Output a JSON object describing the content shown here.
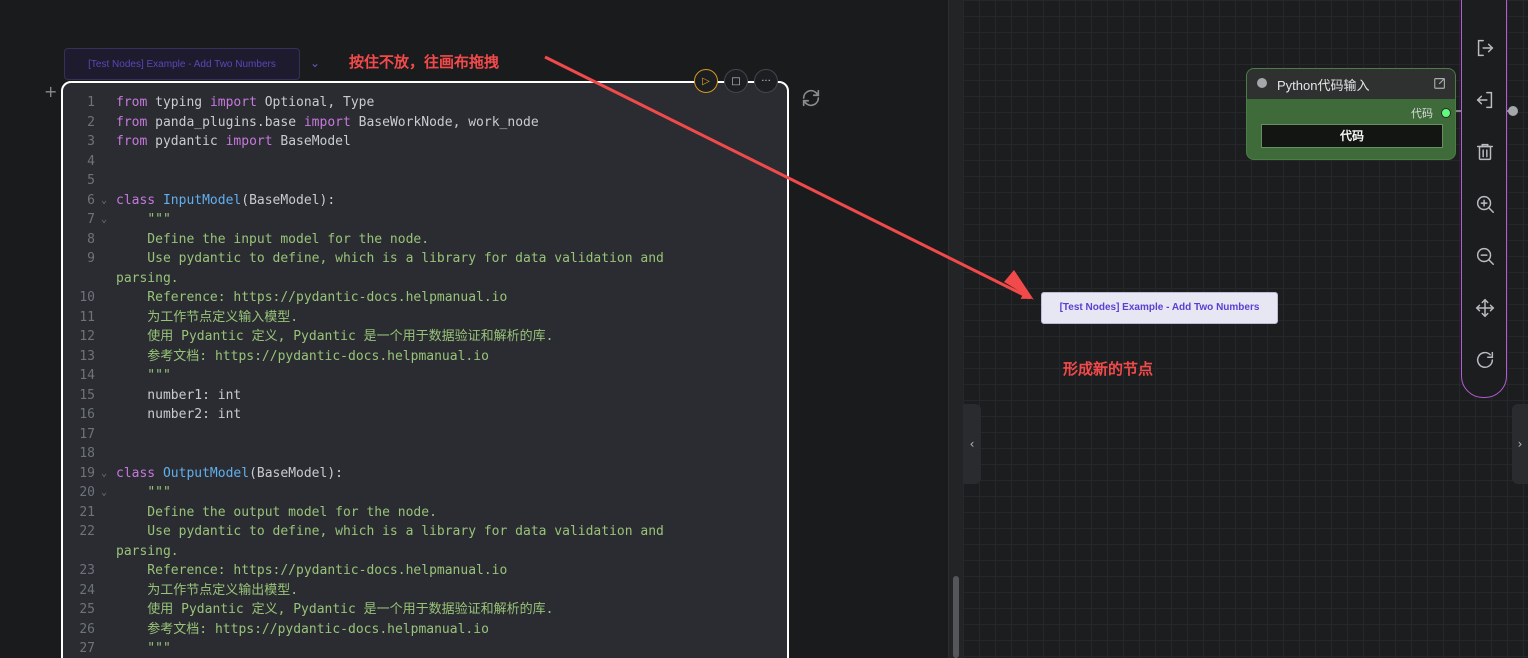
{
  "notebook": {
    "cell_tag": "[Test Nodes] Example - Add Two Numbers",
    "add_cell_glyph": "+",
    "chevron_glyph": "⌄",
    "annotation": "按住不放，往画布拖拽",
    "toolbar": {
      "run_glyph": "▷",
      "stop_glyph": "□",
      "more_glyph": "···"
    },
    "code_lines": [
      {
        "n": "1",
        "fold": "",
        "html": "<span class='kw'>from</span> typing <span class='kw'>import</span> Optional, Type"
      },
      {
        "n": "2",
        "fold": "",
        "html": "<span class='kw'>from</span> panda_plugins.base <span class='kw'>import</span> BaseWorkNode, work_node"
      },
      {
        "n": "3",
        "fold": "",
        "html": "<span class='kw'>from</span> pydantic <span class='kw'>import</span> BaseModel"
      },
      {
        "n": "4",
        "fold": "",
        "html": ""
      },
      {
        "n": "5",
        "fold": "",
        "html": ""
      },
      {
        "n": "6",
        "fold": "⌄",
        "html": "<span class='kw'>class</span> <span class='fn'>InputModel</span>(BaseModel):"
      },
      {
        "n": "7",
        "fold": "⌄",
        "html": "    <span class='str'>\"\"\"</span>"
      },
      {
        "n": "8",
        "fold": "",
        "html": "<span class='str'>    Define the input model for the node.</span>"
      },
      {
        "n": "9",
        "fold": "",
        "html": "<span class='str'>    Use pydantic to define, which is a library for data validation and</span>"
      },
      {
        "n": "",
        "fold": "",
        "html": "<span class='str'>parsing.</span>"
      },
      {
        "n": "10",
        "fold": "",
        "html": "<span class='str'>    Reference: https://pydantic-docs.helpmanual.io</span>"
      },
      {
        "n": "11",
        "fold": "",
        "html": "<span class='str'>    为工作节点定义输入模型.</span>"
      },
      {
        "n": "12",
        "fold": "",
        "html": "<span class='str'>    使用 Pydantic 定义, Pydantic 是一个用于数据验证和解析的库.</span>"
      },
      {
        "n": "13",
        "fold": "",
        "html": "<span class='str'>    参考文档: https://pydantic-docs.helpmanual.io</span>"
      },
      {
        "n": "14",
        "fold": "",
        "html": "<span class='str'>    \"\"\"</span>"
      },
      {
        "n": "15",
        "fold": "",
        "html": "    number1: int"
      },
      {
        "n": "16",
        "fold": "",
        "html": "    number2: int"
      },
      {
        "n": "17",
        "fold": "",
        "html": ""
      },
      {
        "n": "18",
        "fold": "",
        "html": ""
      },
      {
        "n": "19",
        "fold": "⌄",
        "html": "<span class='kw'>class</span> <span class='fn'>OutputModel</span>(BaseModel):"
      },
      {
        "n": "20",
        "fold": "⌄",
        "html": "    <span class='str'>\"\"\"</span>"
      },
      {
        "n": "21",
        "fold": "",
        "html": "<span class='str'>    Define the output model for the node.</span>"
      },
      {
        "n": "22",
        "fold": "",
        "html": "<span class='str'>    Use pydantic to define, which is a library for data validation and</span>"
      },
      {
        "n": "",
        "fold": "",
        "html": "<span class='str'>parsing.</span>"
      },
      {
        "n": "23",
        "fold": "",
        "html": "<span class='str'>    Reference: https://pydantic-docs.helpmanual.io</span>"
      },
      {
        "n": "24",
        "fold": "",
        "html": "<span class='str'>    为工作节点定义输出模型.</span>"
      },
      {
        "n": "25",
        "fold": "",
        "html": "<span class='str'>    使用 Pydantic 定义, Pydantic 是一个用于数据验证和解析的库.</span>"
      },
      {
        "n": "26",
        "fold": "",
        "html": "<span class='str'>    参考文档: https://pydantic-docs.helpmanual.io</span>"
      },
      {
        "n": "27",
        "fold": "",
        "html": "<span class='str'>    \"\"\"</span>"
      }
    ]
  },
  "canvas": {
    "python_node": {
      "title": "Python代码输入",
      "output_label": "代码",
      "field_value": "代码"
    },
    "new_node_label": "[Test Nodes] Example - Add Two Numbers",
    "annotation": "形成新的节点",
    "collapse_left_glyph": "‹",
    "collapse_right_glyph": "›"
  },
  "colors": {
    "accent": "#b65ad7",
    "annotation": "#f24a4a",
    "node_green": "#3f6b3a"
  },
  "icons": [
    "logout-icon",
    "login-icon",
    "trash-icon",
    "zoom-in-icon",
    "zoom-out-icon",
    "move-icon",
    "refresh-icon"
  ]
}
